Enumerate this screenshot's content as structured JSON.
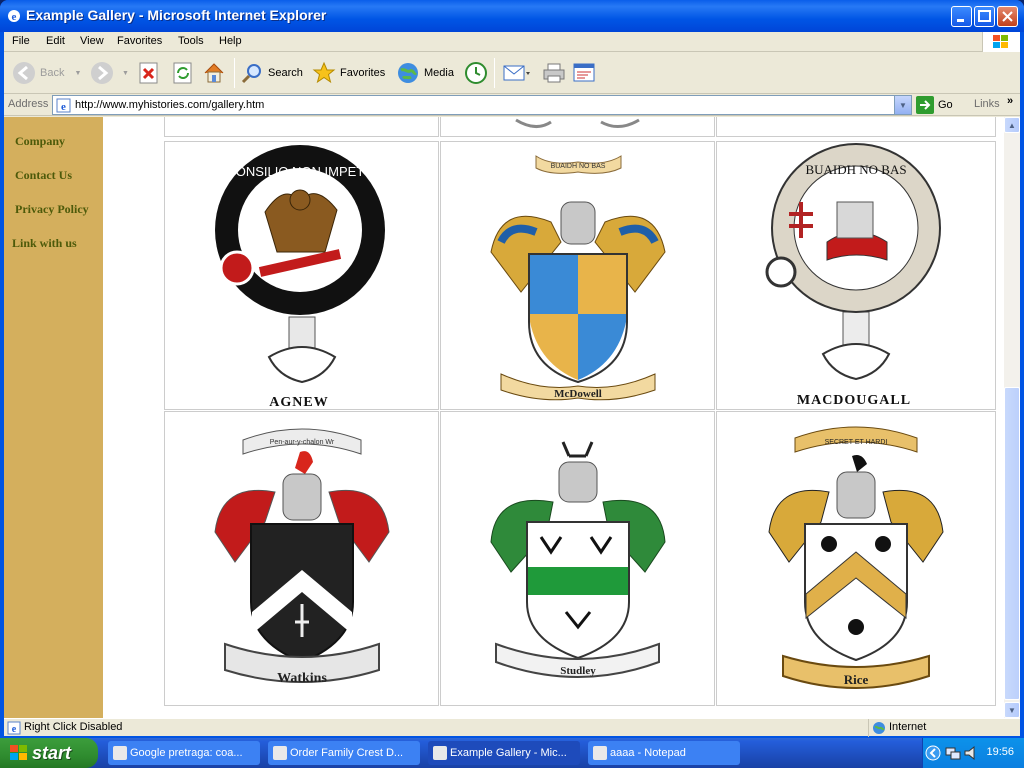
{
  "window": {
    "title": "Example Gallery - Microsoft Internet Explorer"
  },
  "menu": [
    "File",
    "Edit",
    "View",
    "Favorites",
    "Tools",
    "Help"
  ],
  "toolbar": {
    "back": "Back",
    "search": "Search",
    "favorites": "Favorites",
    "media": "Media"
  },
  "address": {
    "label": "Address",
    "url": "http://www.myhistories.com/gallery.htm",
    "go": "Go",
    "links": "Links"
  },
  "sidebar": {
    "items": [
      "Company",
      "Contact Us",
      "Privacy Policy",
      "Link with us"
    ]
  },
  "gallery": {
    "crests": [
      {
        "name": "AGNEW",
        "motto": "CONSILIO NON IMPETU",
        "type": "clan-badge"
      },
      {
        "name": "McDowell",
        "motto": "BUAIDH NO BAS",
        "type": "coat-of-arms"
      },
      {
        "name": "MACDOUGALL",
        "motto": "BUAIDH NO BAS",
        "type": "clan-badge"
      },
      {
        "name": "Watkins",
        "motto": "Pen-aur-y-chalon Wr",
        "type": "coat-of-arms"
      },
      {
        "name": "Studley",
        "motto": "",
        "type": "coat-of-arms"
      },
      {
        "name": "Rice",
        "motto": "SECRET ET HARDI",
        "type": "coat-of-arms"
      }
    ]
  },
  "status": {
    "text": "Right Click Disabled",
    "zone": "Internet"
  },
  "taskbar": {
    "start": "start",
    "tasks": [
      "Google pretraga: coa...",
      "Order Family Crest D...",
      "Example Gallery - Mic...",
      "aaaa - Notepad"
    ],
    "clock": "19:56"
  },
  "colors": {
    "sidebar": "#d4af5d",
    "sidebar_link": "#4d5a0a",
    "titlebar": "#0055e5"
  }
}
